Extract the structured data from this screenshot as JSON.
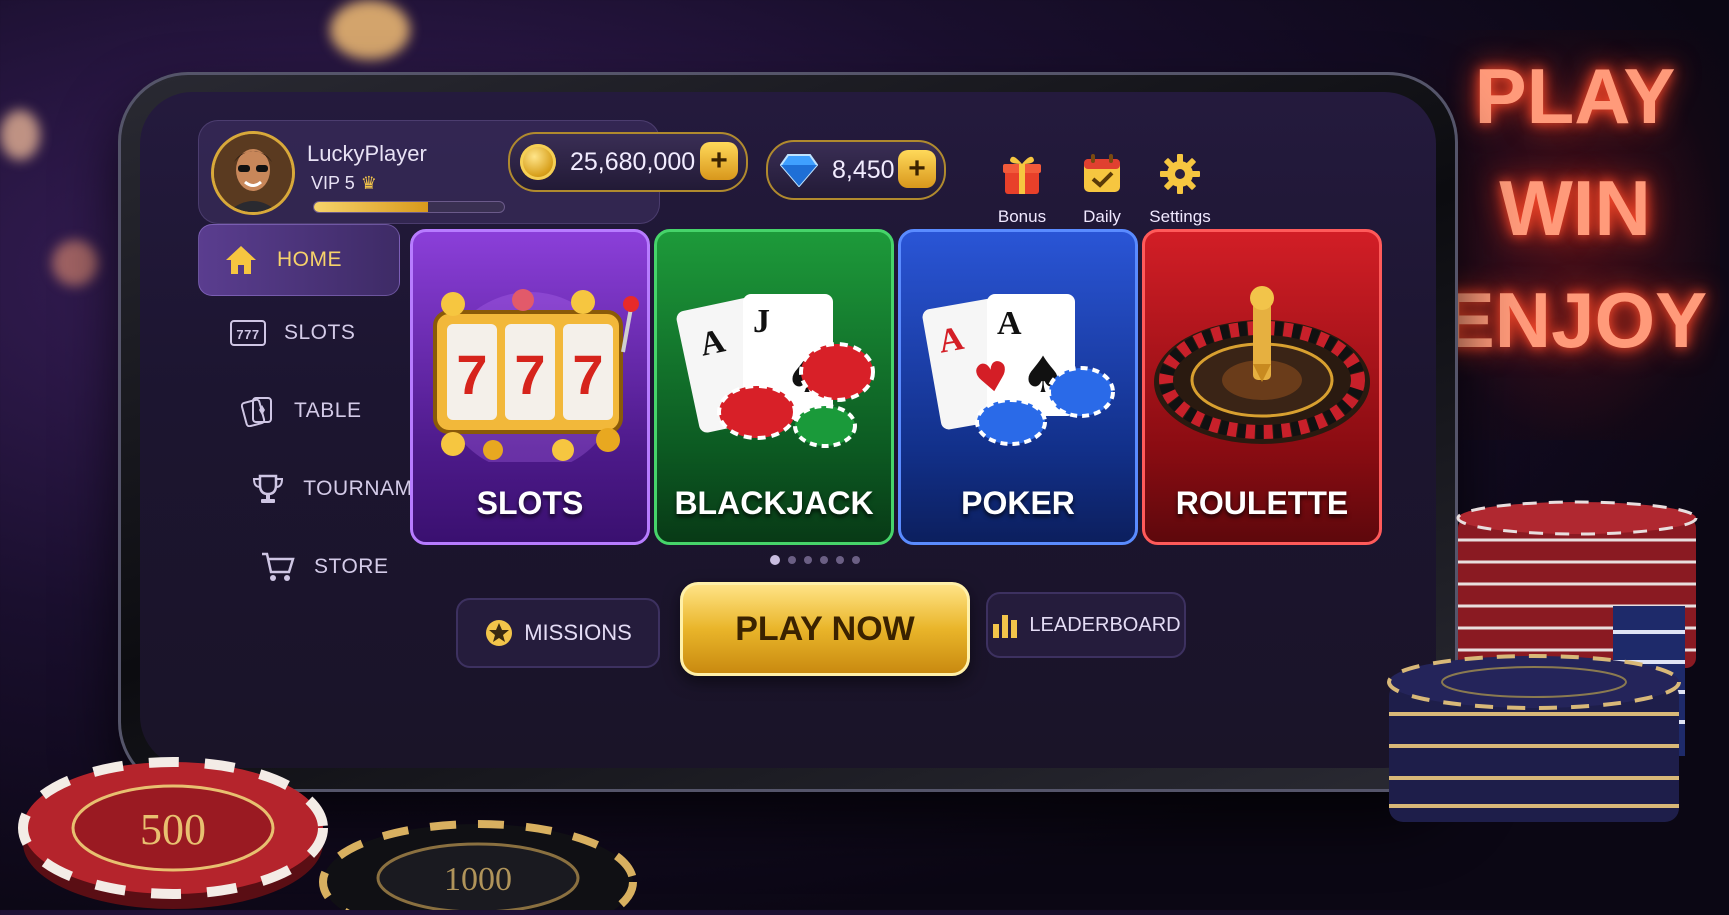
{
  "profile": {
    "username": "LuckyPlayer",
    "vip_label": "VIP 5",
    "crown_icon": "♛",
    "xp_fraction": 0.6
  },
  "currency": {
    "coins": "25,680,000",
    "gems": "8,450",
    "plus_label": "+"
  },
  "top_actions": [
    {
      "label": "Bonus",
      "icon": "gift-icon"
    },
    {
      "label": "Daily",
      "icon": "calendar-check-icon"
    },
    {
      "label": "Settings",
      "icon": "gear-icon"
    }
  ],
  "sidebar": {
    "items": [
      {
        "label": "HOME",
        "icon": "home-icon",
        "active": true
      },
      {
        "label": "SLOTS",
        "icon": "slot-777-icon",
        "active": false
      },
      {
        "label": "TABLE",
        "icon": "cards-icon",
        "active": false
      },
      {
        "label": "TOURNAMENT",
        "icon": "trophy-icon",
        "active": false
      },
      {
        "label": "STORE",
        "icon": "cart-icon",
        "active": false
      }
    ]
  },
  "games": [
    {
      "label": "SLOTS",
      "color": "#8b3fd9",
      "reel": "7"
    },
    {
      "label": "BLACKJACK",
      "color": "#1d9a3a",
      "card1": "A",
      "card2": "J"
    },
    {
      "label": "POKER",
      "color": "#2a55d6",
      "card1": "A",
      "card2": "A"
    },
    {
      "label": "ROULETTE",
      "color": "#d21e26"
    }
  ],
  "carousel": {
    "page_count": 6,
    "active_index": 0
  },
  "actions": {
    "missions": "MISSIONS",
    "play_now": "PLAY NOW",
    "leaderboard": "LEADERBOARD"
  },
  "neon_sign": [
    "PLAY",
    "WIN",
    "ENJOY"
  ],
  "chips": {
    "red": "500",
    "black": "1000"
  },
  "colors": {
    "accent_gold": "#f2c44a",
    "panel": "#241a3d"
  }
}
